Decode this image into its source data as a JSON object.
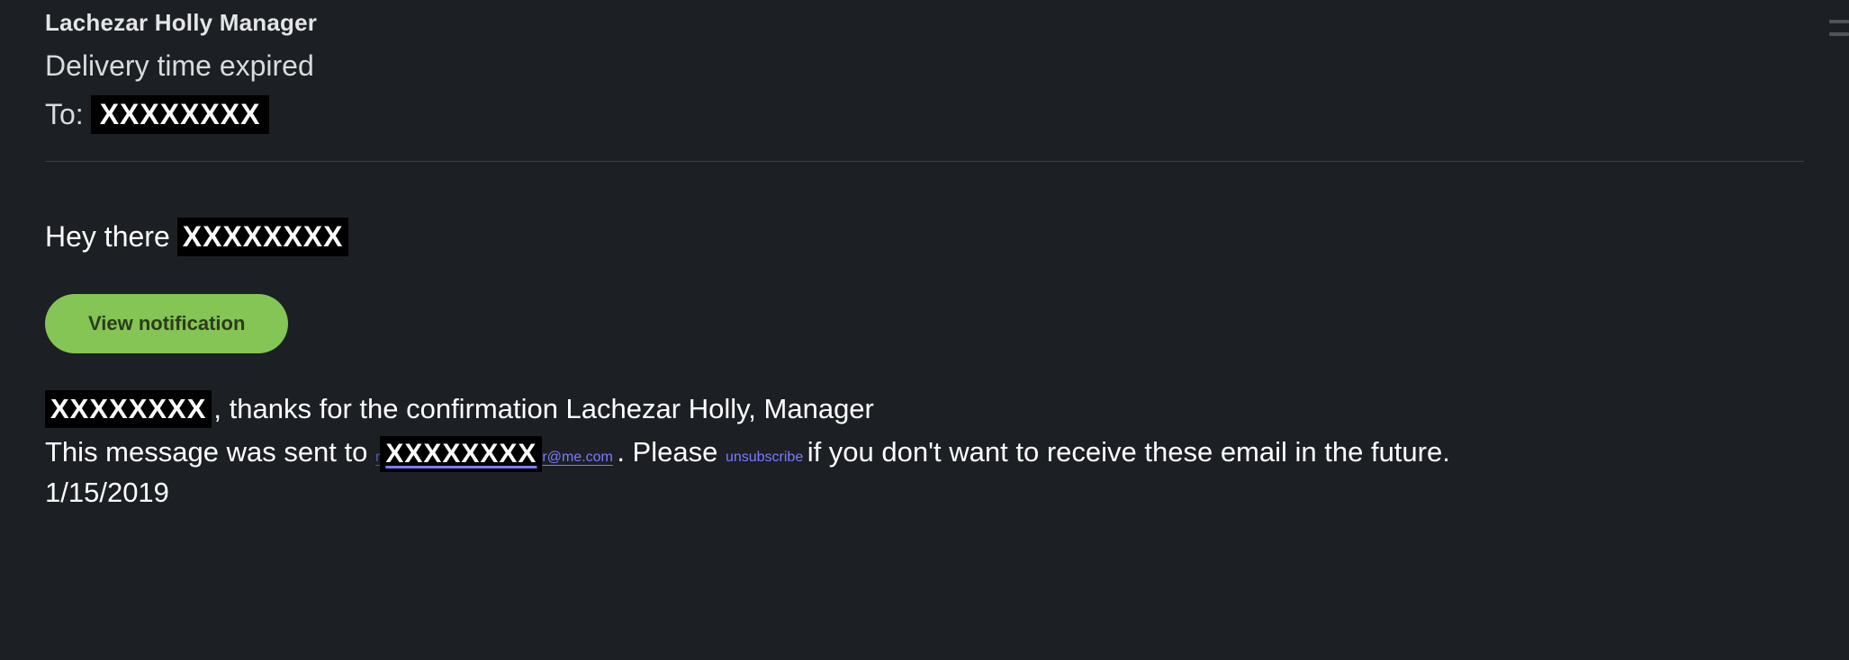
{
  "header": {
    "sender": "Lachezar Holly Manager",
    "subject": "Delivery time expired",
    "to_label": "To:",
    "to_redacted": "XXXXXXXX"
  },
  "body": {
    "greeting_prefix": "Hey there",
    "greeting_name_redacted": "XXXXXXXX",
    "view_button": "View notification",
    "confirm_name_redacted": "XXXXXXXX",
    "confirm_rest": ", thanks for the confirmation Lachezar Holly, Manager",
    "sent_prefix": "This message was sent to ",
    "email_leading_char": "r",
    "email_redacted": "XXXXXXXX",
    "email_tail": "r@me.com",
    "sent_period": ". Please ",
    "unsubscribe": "unsubscribe",
    "sent_suffix": " if you don't want to receive these email in the future.",
    "date": "1/15/2019"
  }
}
